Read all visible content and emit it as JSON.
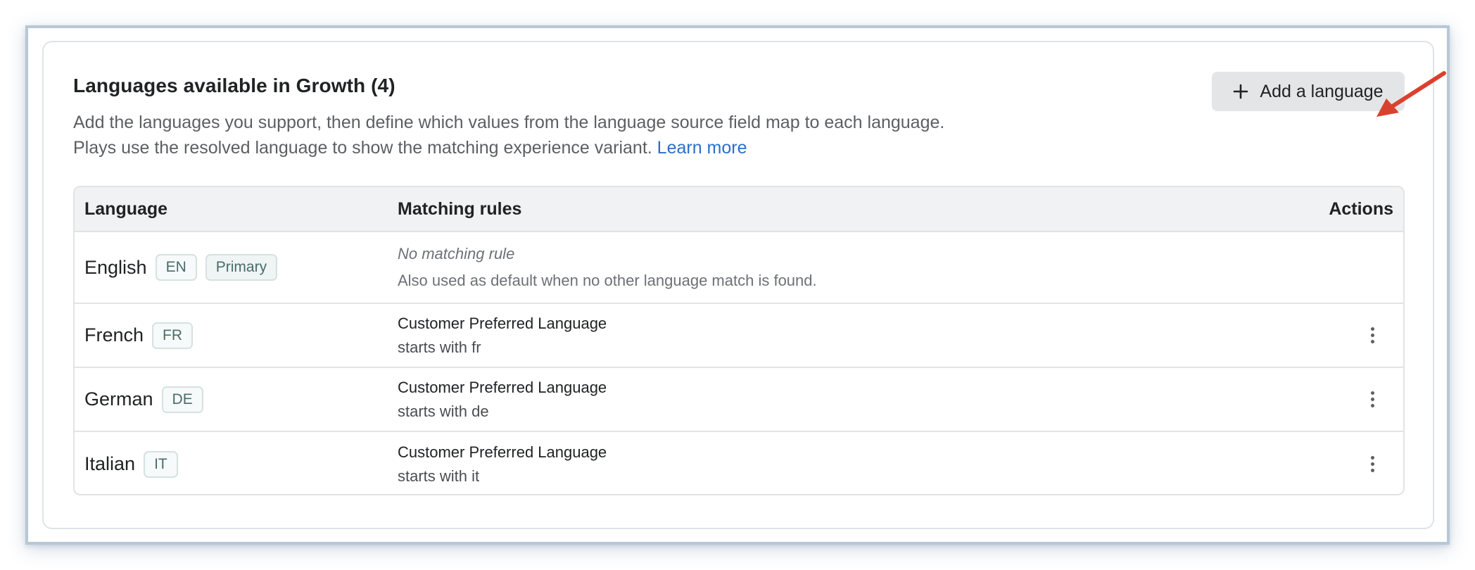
{
  "card": {
    "title": "Languages available in Growth (4)",
    "description": "Add the languages you support, then define which values from the language source field map to each language. Plays use the resolved language to show the matching experience variant.",
    "learn_more": "Learn more",
    "add_button": "Add a language"
  },
  "table": {
    "headers": {
      "language": "Language",
      "rules": "Matching rules",
      "actions": "Actions"
    },
    "rows": [
      {
        "name": "English",
        "code": "EN",
        "primary": "Primary",
        "rule_none": "No matching rule",
        "rule_note": "Also used as default when no other language match is found."
      },
      {
        "name": "French",
        "code": "FR",
        "rule_field": "Customer Preferred Language",
        "rule_cond": "starts with fr"
      },
      {
        "name": "German",
        "code": "DE",
        "rule_field": "Customer Preferred Language",
        "rule_cond": "starts with de"
      },
      {
        "name": "Italian",
        "code": "IT",
        "rule_field": "Customer Preferred Language",
        "rule_cond": "starts with it"
      }
    ]
  },
  "colors": {
    "link": "#2c6ecb",
    "annotation_arrow": "#d9412f",
    "button_bg": "#e4e5e7"
  },
  "icons": {
    "add": "plus-icon",
    "row_actions": "more-vertical-icon",
    "annotation": "red-arrow-annotation"
  }
}
